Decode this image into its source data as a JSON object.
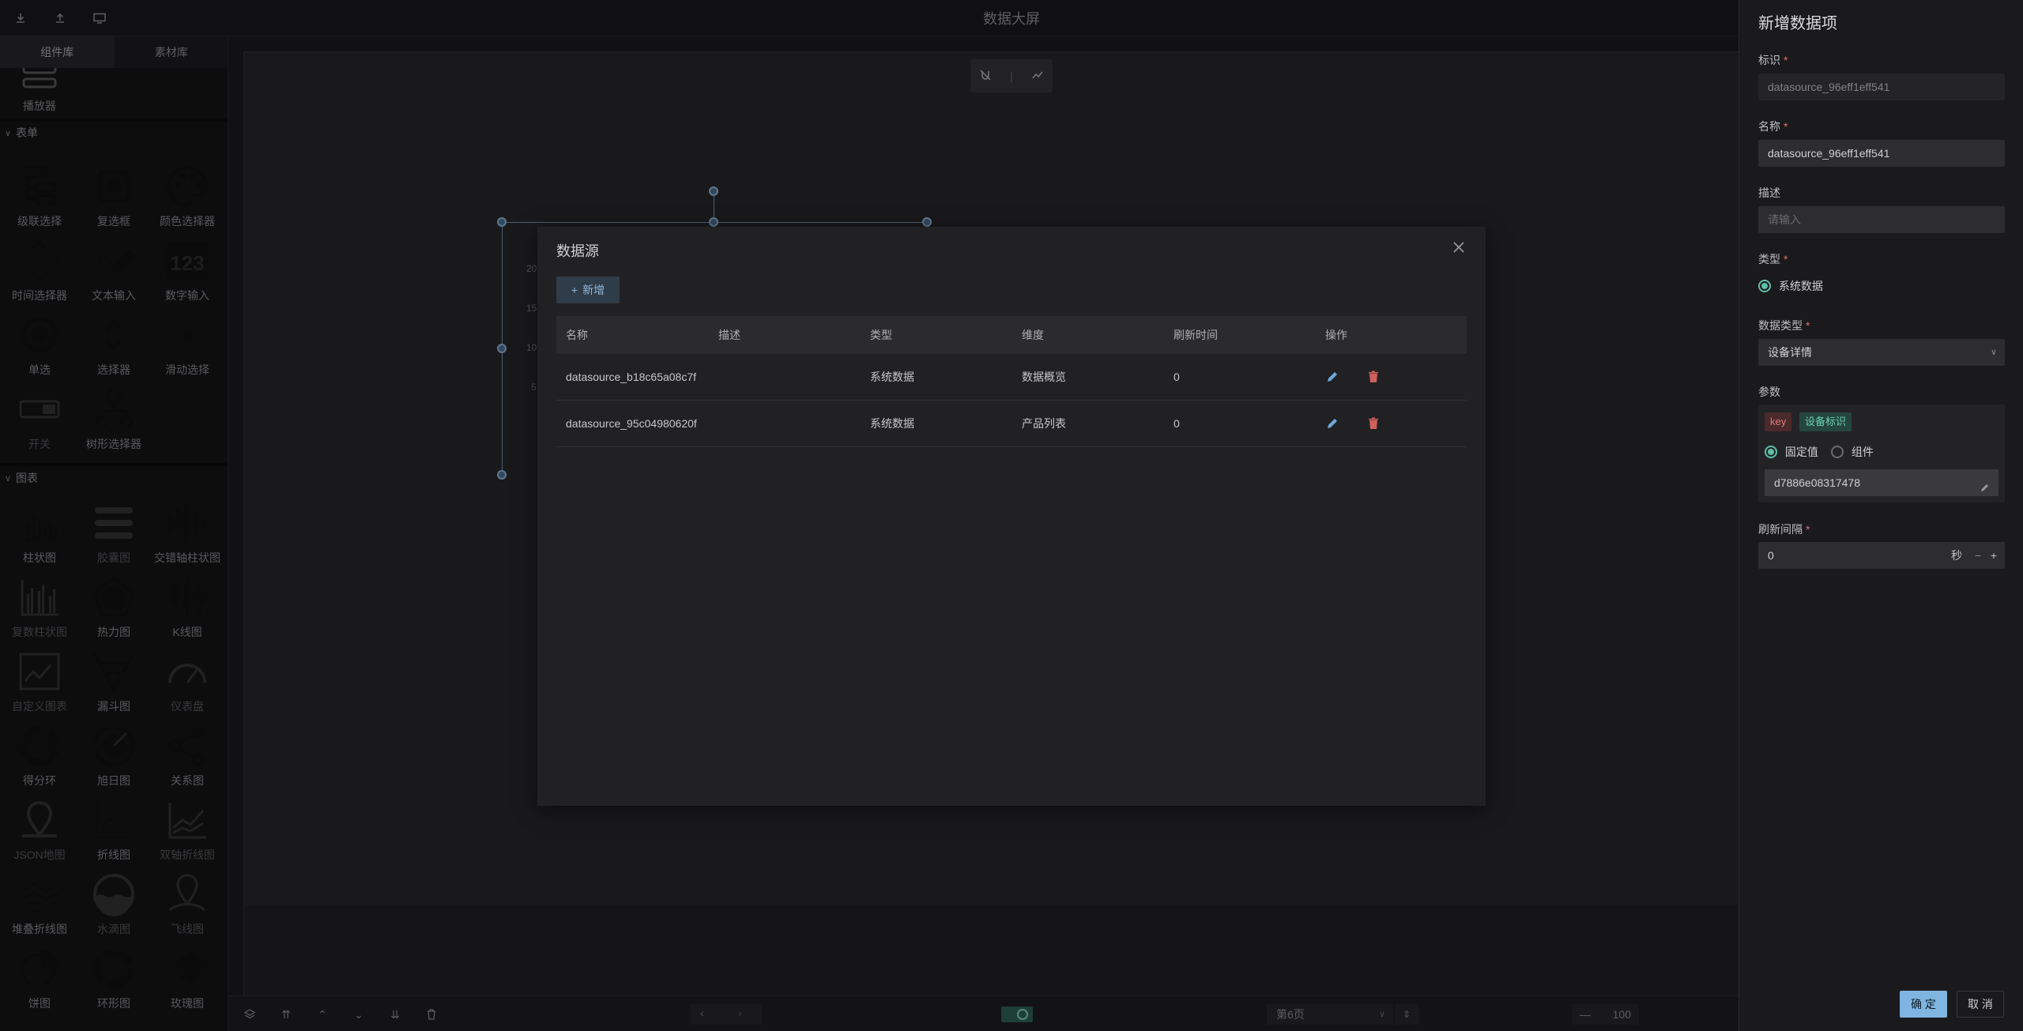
{
  "app": {
    "title": "数据大屏"
  },
  "left_panel": {
    "tabs": [
      "组件库",
      "素材库"
    ],
    "partial_item": "播放器",
    "sections": [
      {
        "name": "表单",
        "items": [
          "级联选择",
          "复选框",
          "颜色选择器",
          "时间选择器",
          "文本输入",
          "数字输入",
          "单选",
          "选择器",
          "滑动选择",
          "开关",
          "树形选择器"
        ]
      },
      {
        "name": "图表",
        "items": [
          "柱状图",
          "胶囊图",
          "交错轴柱状图",
          "复数柱状图",
          "热力图",
          "K线图",
          "自定义图表",
          "漏斗图",
          "仪表盘",
          "得分环",
          "旭日图",
          "关系图",
          "JSON地图",
          "折线图",
          "双轴折线图",
          "堆叠折线图",
          "水滴图",
          "飞线图",
          "饼图",
          "环形图",
          "玫瑰图"
        ]
      }
    ]
  },
  "canvas": {
    "chart_ticks": [
      "20",
      "15",
      "10",
      "5"
    ]
  },
  "bottom_bar": {
    "page": "第6页",
    "zoom": "100"
  },
  "modal": {
    "title": "数据源",
    "add_button": "新增",
    "columns": [
      "名称",
      "描述",
      "类型",
      "维度",
      "刷新时间",
      "操作"
    ],
    "rows": [
      {
        "name": "datasource_b18c65a08c7f",
        "desc": "",
        "type": "系统数据",
        "dimension": "数据概览",
        "refresh": "0"
      },
      {
        "name": "datasource_95c04980620f",
        "desc": "",
        "type": "系统数据",
        "dimension": "产品列表",
        "refresh": "0"
      }
    ]
  },
  "right_panel": {
    "title": "新增数据项",
    "id_label": "标识",
    "id_value": "datasource_96eff1eff541",
    "name_label": "名称",
    "name_value": "datasource_96eff1eff541",
    "desc_label": "描述",
    "desc_placeholder": "请输入",
    "type_label": "类型",
    "type_option": "系统数据",
    "data_type_label": "数据类型",
    "data_type_value": "设备详情",
    "params_label": "参数",
    "param_key": "key",
    "param_name": "设备标识",
    "param_mode_fixed": "固定值",
    "param_mode_component": "组件",
    "param_value": "d7886e08317478",
    "interval_label": "刷新间隔",
    "interval_value": "0",
    "interval_unit": "秒",
    "confirm": "确 定",
    "cancel": "取 消"
  },
  "colors": {
    "accent": "#5fbfa8",
    "primary": "#7fb5e0",
    "danger": "#e06c6c"
  }
}
